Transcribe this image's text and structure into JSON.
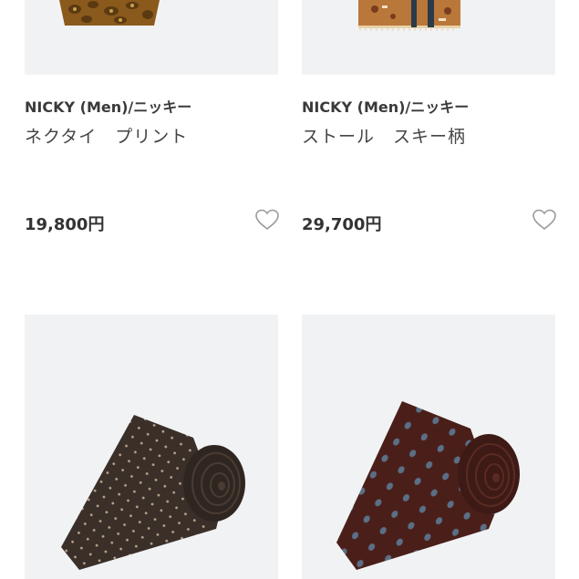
{
  "products": [
    {
      "brand": "NICKY (Men)/ニッキー",
      "name": "ネクタイ　プリント",
      "price": "19,800円",
      "image": "necktie-print-image",
      "favorite_icon": "heart-outline-icon"
    },
    {
      "brand": "NICKY (Men)/ニッキー",
      "name": "ストール　スキー柄",
      "price": "29,700円",
      "image": "stole-ski-pattern-image",
      "favorite_icon": "heart-outline-icon"
    },
    {
      "image": "brown-dot-necktie-image"
    },
    {
      "image": "burgundy-dot-necktie-image"
    }
  ],
  "colors": {
    "card_background": "#f1f2f4",
    "text": "#333333",
    "heart_stroke": "#9a9a9a"
  }
}
